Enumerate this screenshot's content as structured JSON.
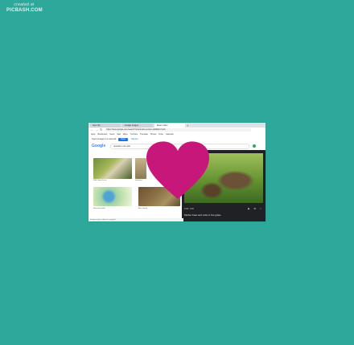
{
  "watermark": {
    "top": "created at",
    "bottom": "PICBASH.COM"
  },
  "browser": {
    "tabs": [
      "New Tab",
      "Google Images",
      "Bears Video"
    ],
    "url": "https://www.google.com/search?q=animals+in+the+wild&tbm=isch",
    "bookmarks": [
      "Apps",
      "Bookmarks",
      "News",
      "Mail",
      "Maps",
      "YouTube",
      "Translate",
      "Photos",
      "Drive",
      "Calendar"
    ]
  },
  "infobar": {
    "text": "Open Images in a new tab",
    "button": "Open",
    "link": "Dismiss"
  },
  "google": {
    "logo": "Google",
    "query": "animals in the wild"
  },
  "results": [
    {
      "caption": "Wild Zebra Facts"
    },
    {
      "caption": "Savanna"
    },
    {
      "caption": "Bee-eater birds"
    },
    {
      "caption": "Bear family"
    }
  ],
  "preview": {
    "label": "0:00 / 0:30",
    "icons": "▶ ⚙ ⛶",
    "title": "Mother bear and cubs in the grass"
  },
  "footer": "Images may be subject to copyright.",
  "colors": {
    "background": "#2fa89c",
    "heart": "#c8177a"
  },
  "icons": [
    "back-icon",
    "forward-icon",
    "reload-icon",
    "heart-icon"
  ]
}
